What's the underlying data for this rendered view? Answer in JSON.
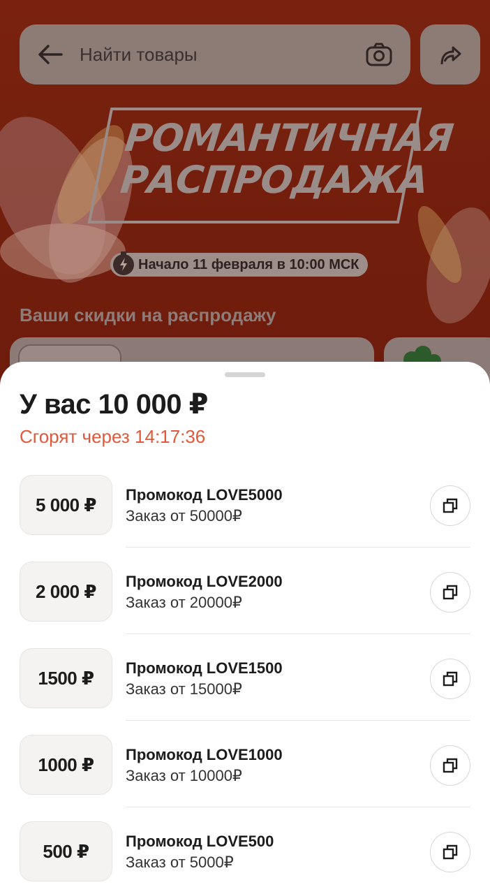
{
  "search": {
    "placeholder": "Найти товары"
  },
  "banner": {
    "title": "РОМАНТИЧНАЯ\nРАСПРОДАЖА",
    "start_text": "Начало 11 февраля в 10:00 МСК"
  },
  "discounts_heading": "Ваши скидки на распродажу",
  "sheet": {
    "title": "У вас 10 000 ₽",
    "expire_text": "Сгорят через 14:17:36"
  },
  "promos": [
    {
      "amount": "5 000 ₽",
      "code": "Промокод LOVE5000",
      "min_order": "Заказ от 50000₽"
    },
    {
      "amount": "2 000 ₽",
      "code": "Промокод LOVE2000",
      "min_order": "Заказ от 20000₽"
    },
    {
      "amount": "1500 ₽",
      "code": "Промокод LOVE1500",
      "min_order": "Заказ от 15000₽"
    },
    {
      "amount": "1000 ₽",
      "code": "Промокод LOVE1000",
      "min_order": "Заказ от 10000₽"
    },
    {
      "amount": "500 ₽",
      "code": "Промокод LOVE500",
      "min_order": "Заказ от 5000₽"
    }
  ],
  "colors": {
    "accent_expire": "#e0593a",
    "background_dim": "#6e1c0c"
  }
}
